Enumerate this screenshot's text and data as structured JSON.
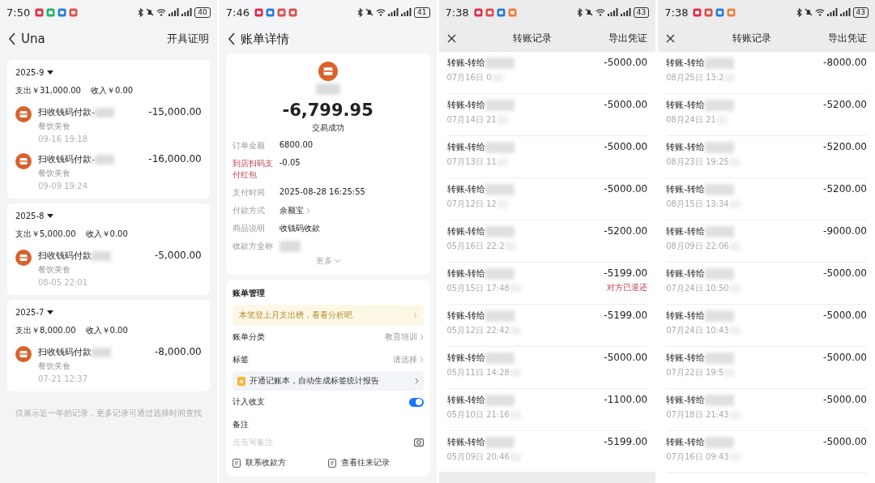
{
  "screens": [
    {
      "kind": "ledger",
      "status": {
        "time": "7:50",
        "battery": "40"
      },
      "header": {
        "title": "Una",
        "action": "开具证明"
      },
      "months": [
        {
          "month": "2025-9",
          "expense": "支出￥31,000.00",
          "income": "收入￥0.00",
          "items": [
            {
              "title": "扫收钱码付款-",
              "category": "餐饮美食",
              "time": "09-16 19:18",
              "amount": "-15,000.00"
            },
            {
              "title": "扫收钱码付款-",
              "category": "餐饮美食",
              "time": "09-09 19:24",
              "amount": "-16,000.00"
            }
          ]
        },
        {
          "month": "2025-8",
          "expense": "支出￥5,000.00",
          "income": "收入￥0.00",
          "items": [
            {
              "title": "扫收钱码付款",
              "category": "餐饮美食",
              "time": "08-05 22:01",
              "amount": "-5,000.00"
            }
          ]
        },
        {
          "month": "2025-7",
          "expense": "支出￥8,000.00",
          "income": "收入￥0.00",
          "items": [
            {
              "title": "扫收钱码付款",
              "category": "餐饮美食",
              "time": "07-21 12:37",
              "amount": "-8,000.00"
            }
          ]
        }
      ],
      "footer": "仅展示近一年的记录，更多记录可通过选择时间查找"
    },
    {
      "kind": "detail",
      "status": {
        "time": "7:46",
        "battery": "41"
      },
      "header": {
        "title": "账单详情"
      },
      "amount": "-6,799.95",
      "result": "交易成功",
      "fields": [
        {
          "label": "订单金额",
          "value": "6800.00",
          "highlight": false,
          "link": false
        },
        {
          "label": "到店扫码支付红包",
          "value": "-0.05",
          "highlight": true,
          "link": false
        },
        {
          "label": "支付时间",
          "value": "2025-08-28 16:25:55",
          "highlight": false,
          "link": false
        },
        {
          "label": "付款方式",
          "value": "余额宝",
          "highlight": false,
          "link": true
        },
        {
          "label": "商品说明",
          "value": "收钱码收款",
          "highlight": false,
          "link": false
        },
        {
          "label": "收款方全称",
          "highlight": false
        }
      ],
      "more": "更多",
      "management": {
        "title": "账单管理",
        "tip": "本笔登上月支出榜，看看分析吧",
        "category_label": "账单分类",
        "category_value": "教育培训",
        "tag_label": "标签",
        "tag_value": "请选择",
        "promo": "开通记账本，自动生成标签统计报告",
        "include_label": "计入收支",
        "include_on": true,
        "note_label": "备注",
        "note_placeholder": "点击写备注"
      },
      "actions": [
        "联系收款方",
        "查看往来记录"
      ]
    },
    {
      "kind": "transfers",
      "status": {
        "time": "7:38",
        "battery": "43"
      },
      "header": {
        "title": "转账记录",
        "action": "导出凭证"
      },
      "rows": [
        {
          "title": "转账-转给",
          "date": "07月16日 0",
          "amount": "-5000.00"
        },
        {
          "title": "转账-转给",
          "date": "07月14日 21",
          "amount": "-5000.00"
        },
        {
          "title": "转账-转给",
          "date": "07月13日 11",
          "amount": "-5000.00"
        },
        {
          "title": "转账-转给",
          "date": "07月12日 12",
          "amount": "-5000.00"
        },
        {
          "title": "转账-转给",
          "date": "05月16日 22:2",
          "amount": "-5200.00"
        },
        {
          "title": "转账-转给",
          "date": "05月15日 17:48",
          "amount": "-5199.00",
          "note": "对方已退还"
        },
        {
          "title": "转账-转给",
          "date": "05月12日 22:42",
          "amount": "-5199.00"
        },
        {
          "title": "转账-转给",
          "date": "05月11日 14:28",
          "amount": "-5000.00"
        },
        {
          "title": "转账-转给",
          "date": "05月10日 21:16",
          "amount": "-1100.00"
        },
        {
          "title": "转账-转给",
          "date": "05月09日 20:46",
          "amount": "-5199.00"
        }
      ]
    },
    {
      "kind": "transfers",
      "status": {
        "time": "7:38",
        "battery": "43"
      },
      "header": {
        "title": "转账记录",
        "action": "导出凭证"
      },
      "rows": [
        {
          "title": "转账-转给",
          "date": "08月25日 13:2",
          "amount": "-8000.00"
        },
        {
          "title": "转账-转给",
          "date": "08月24日 21",
          "amount": "-5200.00"
        },
        {
          "title": "转账-转给",
          "date": "08月23日 19:25",
          "amount": "-5200.00"
        },
        {
          "title": "转账-转给",
          "date": "08月15日 13:34",
          "amount": "-5200.00"
        },
        {
          "title": "转账-转给",
          "date": "08月09日 22:06",
          "amount": "-9000.00"
        },
        {
          "title": "转账-转给",
          "date": "07月24日 10:50",
          "amount": "-5000.00"
        },
        {
          "title": "转账-转给",
          "date": "07月24日 10:43",
          "amount": "-5000.00"
        },
        {
          "title": "转账-转给",
          "date": "07月22日 19:5",
          "amount": "-5000.00"
        },
        {
          "title": "转账-转给",
          "date": "07月18日 21:43",
          "amount": "-5000.00"
        },
        {
          "title": "转账-转给",
          "date": "07月16日 09:43",
          "amount": "-5000.00"
        }
      ]
    }
  ]
}
